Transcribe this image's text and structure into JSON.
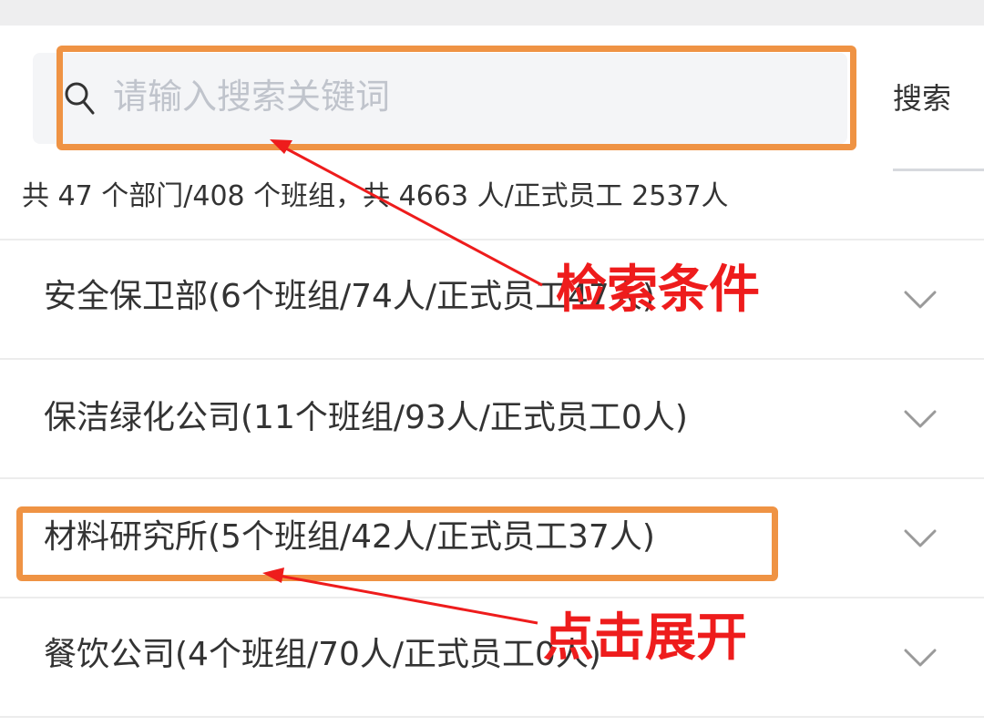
{
  "search": {
    "placeholder": "请输入搜索关键词",
    "button_label": "搜索"
  },
  "summary_text": "共 47 个部门/408 个班组，共 4663 人/正式员工 2537人",
  "departments": [
    {
      "label": "安全保卫部(6个班组/74人/正式员工47人)"
    },
    {
      "label": "保洁绿化公司(11个班组/93人/正式员工0人)"
    },
    {
      "label": "材料研究所(5个班组/42人/正式员工37人)"
    },
    {
      "label": "餐饮公司(4个班组/70人/正式员工0人)"
    }
  ],
  "annotations": {
    "search_condition": "检索条件",
    "click_expand": "点击展开",
    "color_text": "#ee1c1c",
    "color_box": "#ef9344"
  },
  "icons": {
    "search": "search-icon",
    "expand": "chevron-down-icon"
  }
}
